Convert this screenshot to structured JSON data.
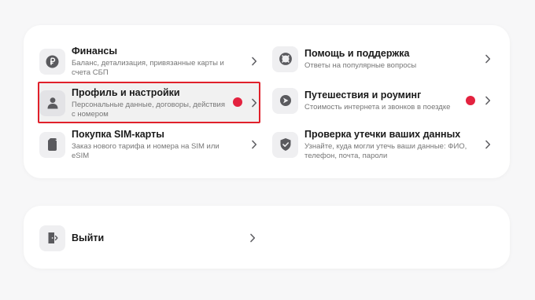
{
  "menu": {
    "items": [
      {
        "title": "Финансы",
        "subtitle": "Баланс, детализация, привязанные карты и счета СБП",
        "icon": "ruble-coin-icon"
      },
      {
        "title": "Профиль и настройки",
        "subtitle": "Персональные данные, договоры, действия с номером",
        "icon": "person-icon",
        "badge": true
      },
      {
        "title": "Покупка SIM-карты",
        "subtitle": "Заказ нового тарифа и номера на SIM или eSIM",
        "icon": "sim-card-icon"
      },
      {
        "title": "Помощь и поддержка",
        "subtitle": "Ответы на популярные вопросы",
        "icon": "lifebuoy-icon"
      },
      {
        "title": "Путешествия и роуминг",
        "subtitle": "Стоимость интернета и звонков в поездке",
        "icon": "travel-icon",
        "badge": true
      },
      {
        "title": "Проверка утечки ваших данных",
        "subtitle": "Узнайте, куда могли утечь ваши данные: ФИО, телефон, почта, пароли",
        "icon": "shield-check-icon"
      }
    ]
  },
  "exit": {
    "label": "Выйти",
    "icon": "exit-door-icon"
  },
  "colors": {
    "badge": "#e3223f",
    "highlight_border": "#e0202a",
    "icon_bg": "#efeff1"
  }
}
